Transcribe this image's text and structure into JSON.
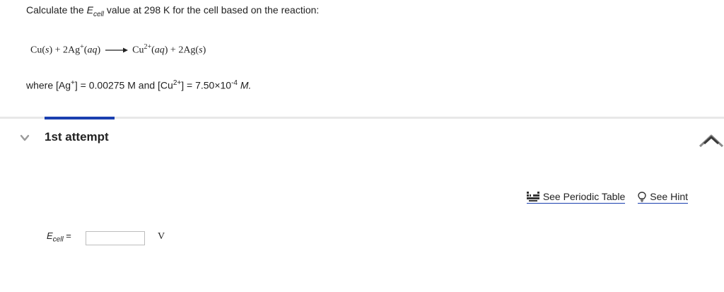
{
  "question": {
    "prefix": "Calculate the ",
    "e_symbol": "E",
    "e_sub": "cell",
    "suffix": " value at 298 K for the cell based on the reaction:"
  },
  "reaction": {
    "r1": "Cu(",
    "r1_state": "s",
    "r1_close": ") + 2Ag",
    "r2_charge": "+",
    "r2_open": "(",
    "r2_state": "aq",
    "r2_close": ")",
    "p1": "Cu",
    "p1_charge": "2+",
    "p1_open": "(",
    "p1_state": "aq",
    "p1_close": ") + 2Ag(",
    "p2_state": "s",
    "p2_close": ")"
  },
  "where": {
    "t1": "where [Ag",
    "t1_sup": "+",
    "t2": "] = 0.00275 M and [Cu",
    "t2_sup": "2+",
    "t3": "] = 7.50×10",
    "t3_sup": "-4",
    "t4": " M."
  },
  "attempt": {
    "title": "1st attempt"
  },
  "tools": {
    "periodic_table": "See Periodic Table",
    "hint": "See Hint"
  },
  "answer": {
    "label_symbol": "E",
    "label_sub": "cell",
    "label_eq": " =",
    "value": "",
    "unit": "V"
  },
  "colors": {
    "accent": "#1a3fb0",
    "divider": "#e8e8e8"
  }
}
